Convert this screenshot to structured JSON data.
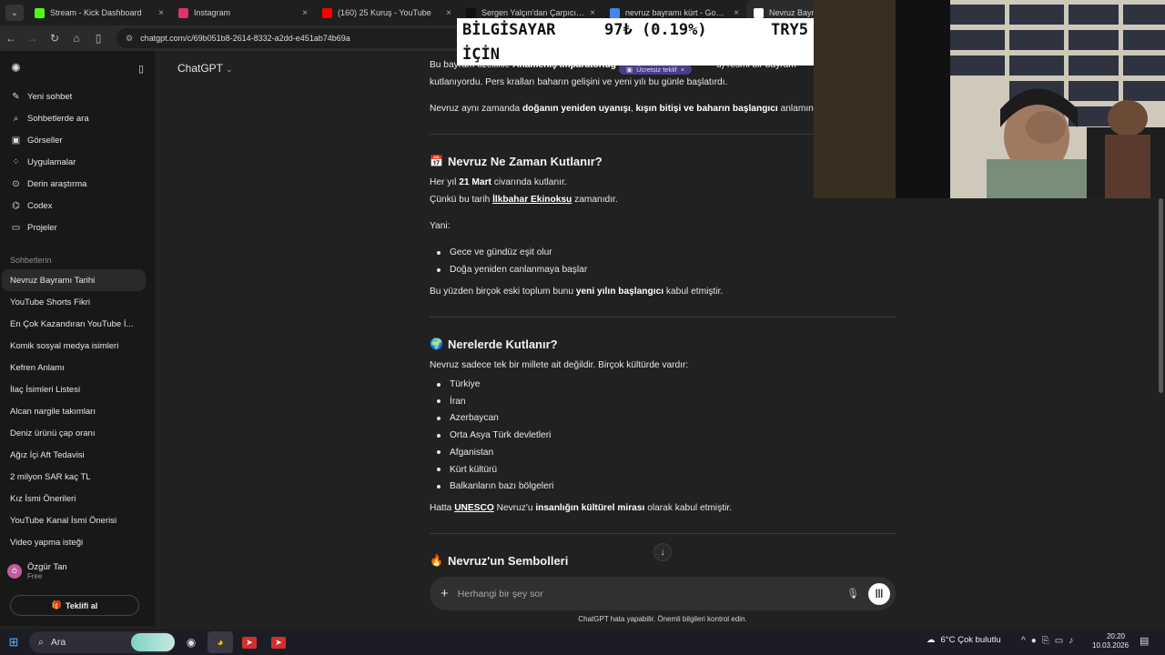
{
  "browser": {
    "tabs": [
      {
        "label": "Stream - Kick Dashboard",
        "fav": "#53fc18"
      },
      {
        "label": "Instagram",
        "fav": "#e1306c"
      },
      {
        "label": "(160) 25 Kuruş - YouTube",
        "fav": "#ff0000"
      },
      {
        "label": "Sergen Yalçın'dan Çarpıcı Açıkla",
        "fav": "#111111"
      },
      {
        "label": "nevruz bayramı kürt - Google'd",
        "fav": "#4285f4"
      },
      {
        "label": "Nevruz Bayram",
        "fav": "#ffffff"
      }
    ],
    "url": "chatgpt.com/c/69b051b8-2614-8332-a2dd-e451ab74b69a"
  },
  "sidebar": {
    "actions": [
      {
        "label": "Yeni sohbet",
        "icon": "edit-icon"
      },
      {
        "label": "Sohbetlerde ara",
        "icon": "search-icon"
      },
      {
        "label": "Görseller",
        "icon": "image-icon"
      },
      {
        "label": "Uygulamalar",
        "icon": "apps-icon"
      },
      {
        "label": "Derin araştırma",
        "icon": "telescope-icon"
      },
      {
        "label": "Codex",
        "icon": "codex-icon"
      },
      {
        "label": "Projeler",
        "icon": "folder-icon"
      }
    ],
    "section_title": "Sohbetlerin",
    "chats": [
      "Nevruz Bayramı Tarihi",
      "YouTube Shorts Fikri",
      "En Çok Kazandıran YouTube İ...",
      "Komik sosyal medya isimleri",
      "Kefren Anlamı",
      "İlaç İsimleri Listesi",
      "Alcan nargile takımları",
      "Deniz ürünü çap oranı",
      "Ağız İçi Aft Tedavisi",
      "2 milyon SAR kaç TL",
      "Kız İsmi Önerileri",
      "YouTube Kanal İsmi Önerisi",
      "Video yapma isteği"
    ],
    "user": {
      "name": "Özgür Tan",
      "plan": "Free",
      "initial": "Ö"
    },
    "offer_button": "Teklifi al"
  },
  "main": {
    "model": "ChatGPT",
    "free_offer_pill": "Ücretsiz teklif",
    "intro_line1_a": "Bu bayram özellikle ",
    "intro_line1_b": "Ahameniş İmparatorluğ",
    "intro_line1_c": "u) resmi bir bayram",
    "intro_line2": "kutlanıyordu. Pers kralları baharın gelişini ve yeni yılı bu günle başlatırdı.",
    "intro_line3_a": "Nevruz aynı zamanda ",
    "intro_line3_b": "doğanın yeniden uyanışı",
    "intro_line3_c": ", ",
    "intro_line3_d": "kışın bitişi ve baharın başlangıcı",
    "intro_line3_e": " anlamına",
    "sec1_title": "Nevruz Ne Zaman Kutlanır?",
    "sec1_emoji": "📅",
    "sec1_p1_a": "Her yıl ",
    "sec1_p1_b": "21 Mart",
    "sec1_p1_c": " civarında kutlanır.",
    "sec1_p2_a": "Çünkü bu tarih ",
    "sec1_p2_b": "İlkbahar Ekinoksu",
    "sec1_p2_c": " zamanıdır.",
    "sec1_p3": "Yani:",
    "sec1_bullets": [
      "Gece ve gündüz eşit olur",
      "Doğa yeniden canlanmaya başlar"
    ],
    "sec1_p4_a": "Bu yüzden birçok eski toplum bunu ",
    "sec1_p4_b": "yeni yılın başlangıcı",
    "sec1_p4_c": " kabul etmiştir.",
    "sec2_title": "Nerelerde Kutlanır?",
    "sec2_emoji": "🌍",
    "sec2_p1": "Nevruz sadece tek bir millete ait değildir. Birçok kültürde vardır:",
    "sec2_bullets": [
      "Türkiye",
      "İran",
      "Azerbaycan",
      "Orta Asya Türk devletleri",
      "Afganistan",
      "Kürt kültürü",
      "Balkanların bazı bölgeleri"
    ],
    "sec2_p2_a": "Hatta ",
    "sec2_p2_b": "UNESCO",
    "sec2_p2_c": " Nevruz'u ",
    "sec2_p2_d": "insanlığın kültürel mirası",
    "sec2_p2_e": " olarak kabul etmiştir.",
    "sec3_title": "Nevruz'un Sembolleri",
    "sec3_emoji": "🔥",
    "composer_placeholder": "Herhangi bir şey sor",
    "disclaimer": "ChatGPT hata yapabilir. Önemli bilgileri kontrol edin."
  },
  "overlay": {
    "ticker_left": "BİLGİSAYAR",
    "ticker_left2": "İÇİN",
    "ticker_value": "97₺ (0.19%)",
    "ticker_right": "TRY5"
  },
  "taskbar": {
    "search": "Ara",
    "weather": "6°C  Çok bulutlu",
    "time": "20:20",
    "date": "10.03.2026"
  }
}
